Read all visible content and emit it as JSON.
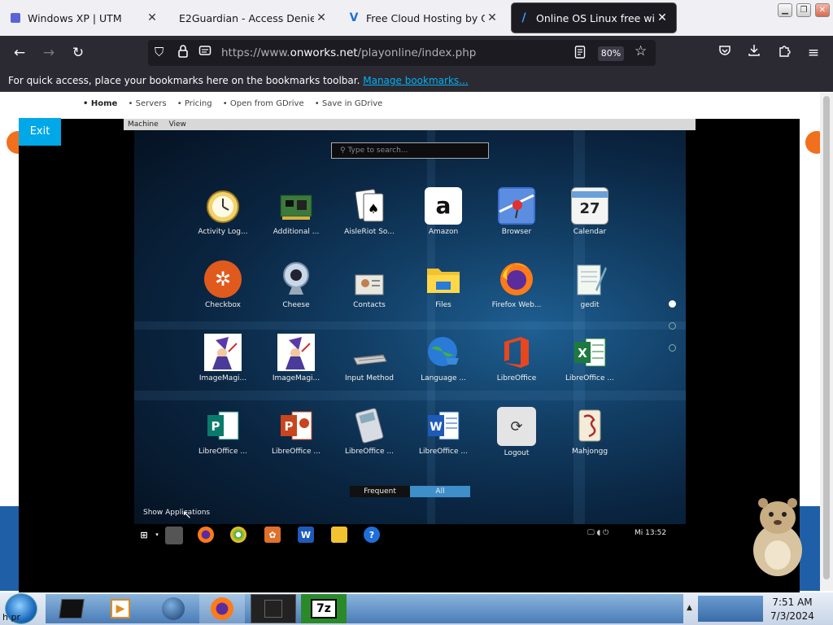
{
  "browser": {
    "tabs": [
      {
        "title": "Windows XP | UTM",
        "active": false
      },
      {
        "title": "E2Guardian - Access Denied",
        "active": false
      },
      {
        "title": "Free Cloud Hosting by OnWo",
        "active": false
      },
      {
        "title": "Online OS Linux free with Or",
        "active": true
      }
    ],
    "url_prefix": "https://www.",
    "url_domain": "onworks.net",
    "url_path": "/playonline/index.php",
    "zoom": "80%",
    "bookmarks_hint": "For quick access, place your bookmarks here on the bookmarks toolbar.",
    "bookmarks_link": "Manage bookmarks..."
  },
  "site": {
    "nav": [
      "• Home",
      "• Servers",
      "• Pricing",
      "• Open from GDrive",
      "• Save in GDrive"
    ],
    "exit_label": "Exit"
  },
  "vm": {
    "menu": [
      "Machine",
      "View"
    ],
    "search_placeholder": "Type to search...",
    "apps": [
      {
        "name": "Activity Log...",
        "icon": "clock-icon"
      },
      {
        "name": "Additional ...",
        "icon": "circuit-board-icon"
      },
      {
        "name": "AisleRiot So...",
        "icon": "playing-cards-icon"
      },
      {
        "name": "Amazon",
        "icon": "amazon-icon"
      },
      {
        "name": "Browser",
        "icon": "map-pin-icon"
      },
      {
        "name": "Calendar",
        "icon": "calendar-icon"
      },
      {
        "name": "Checkbox",
        "icon": "gear-icon"
      },
      {
        "name": "Cheese",
        "icon": "webcam-icon"
      },
      {
        "name": "Contacts",
        "icon": "contact-card-icon"
      },
      {
        "name": "Files",
        "icon": "folder-icon"
      },
      {
        "name": "Firefox Web...",
        "icon": "firefox-icon"
      },
      {
        "name": "gedit",
        "icon": "notepad-icon"
      },
      {
        "name": "ImageMagi...",
        "icon": "wizard-icon"
      },
      {
        "name": "ImageMagi...",
        "icon": "wizard-icon"
      },
      {
        "name": "Input Method",
        "icon": "keyboard-icon"
      },
      {
        "name": "Language ...",
        "icon": "globe-icon"
      },
      {
        "name": "LibreOffice",
        "icon": "office-icon"
      },
      {
        "name": "LibreOffice ...",
        "icon": "excel-icon"
      },
      {
        "name": "LibreOffice ...",
        "icon": "publisher-icon"
      },
      {
        "name": "LibreOffice ...",
        "icon": "powerpoint-icon"
      },
      {
        "name": "LibreOffice ...",
        "icon": "calculator-icon"
      },
      {
        "name": "LibreOffice ...",
        "icon": "word-icon"
      },
      {
        "name": "Logout",
        "icon": "logout-icon"
      },
      {
        "name": "Mahjongg",
        "icon": "mahjong-tile-icon"
      }
    ],
    "calendar_day": "27",
    "tabs": {
      "frequent": "Frequent",
      "all": "All"
    },
    "show_applications": "Show Applications",
    "clock": "Mi 13:52"
  },
  "host": {
    "clock_time": "7:51 AM",
    "clock_date": "7/3/2024",
    "truncated_label": "h pr"
  }
}
